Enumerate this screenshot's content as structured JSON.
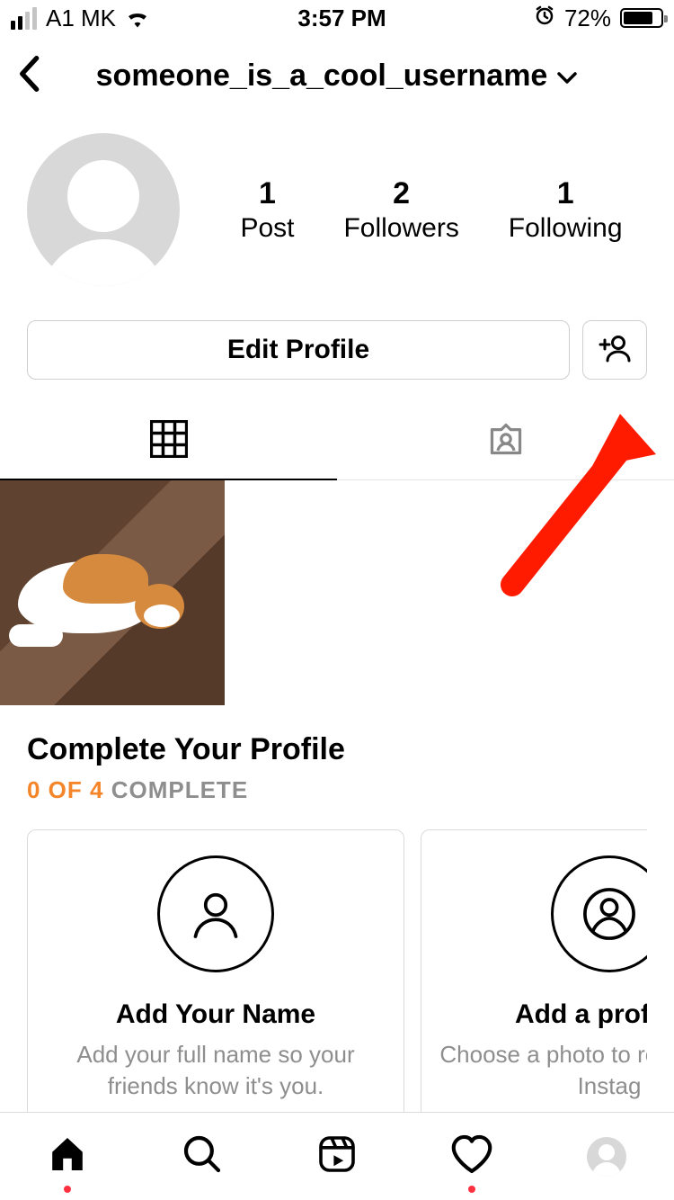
{
  "status": {
    "carrier": "A1 MK",
    "time": "3:57 PM",
    "battery_pct": "72%"
  },
  "header": {
    "username": "someone_is_a_cool_username"
  },
  "stats": {
    "posts": {
      "count": "1",
      "label": "Post"
    },
    "followers": {
      "count": "2",
      "label": "Followers"
    },
    "following": {
      "count": "1",
      "label": "Following"
    }
  },
  "buttons": {
    "edit_profile": "Edit Profile"
  },
  "complete": {
    "title": "Complete Your Profile",
    "progress_highlight": "0 OF 4",
    "progress_rest": " COMPLETE",
    "cards": [
      {
        "title": "Add Your Name",
        "desc": "Add your full name so your friends know it's you."
      },
      {
        "title": "Add a profile p",
        "desc": "Choose a photo to re yourself on Instag"
      }
    ]
  }
}
